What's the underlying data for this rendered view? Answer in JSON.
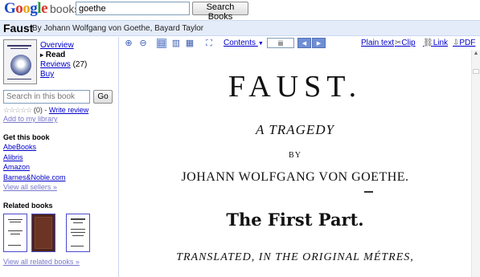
{
  "header": {
    "logo_parts": [
      {
        "ch": "G",
        "color": "#1a4ac8"
      },
      {
        "ch": "o",
        "color": "#d9342b"
      },
      {
        "ch": "o",
        "color": "#e8a800"
      },
      {
        "ch": "g",
        "color": "#1a4ac8"
      },
      {
        "ch": "l",
        "color": "#1f9c3a"
      },
      {
        "ch": "e",
        "color": "#d9342b"
      }
    ],
    "logo_suffix": "books",
    "search_value": "goethe",
    "search_button": "Search Books"
  },
  "book": {
    "title": "Faust",
    "authors": "By Johann Wolfgang von Goethe, Bayard Taylor"
  },
  "sidebar": {
    "nav": {
      "overview": "Overview",
      "read": "Read",
      "reviews": "Reviews",
      "reviews_count": "(27)",
      "buy": "Buy"
    },
    "search_in_book_placeholder": "Search in this book",
    "search_in_book_button": "Go",
    "rating_stars": "☆☆☆☆☆",
    "rating_count": "(0) -",
    "write_review": "Write review",
    "add_library": "Add to my library",
    "get_book_heading": "Get this book",
    "sellers": [
      "AbeBooks",
      "Alibris",
      "Amazon",
      "Barnes&Noble.com"
    ],
    "view_all_sellers": "View all sellers »",
    "related_heading": "Related books",
    "view_all_related": "View all related books »"
  },
  "toolbar": {
    "contents": "Contents",
    "page_value": "iii",
    "plain_text": "Plain text",
    "clip": "Clip",
    "link": "Link",
    "pdf": "PDF"
  },
  "page_content": {
    "title": "FAUST.",
    "subtitle": "A TRAGEDY",
    "by": "BY",
    "author": "JOHANN WOLFGANG VON GOETHE.",
    "part": "The First Part.",
    "translated": "TRANSLATED, IN THE ORIGINAL MÉTRES,"
  },
  "colors": {
    "link": "#0000cc",
    "title_bar_bg": "#e5ecf9",
    "border": "#c9d7f1"
  }
}
